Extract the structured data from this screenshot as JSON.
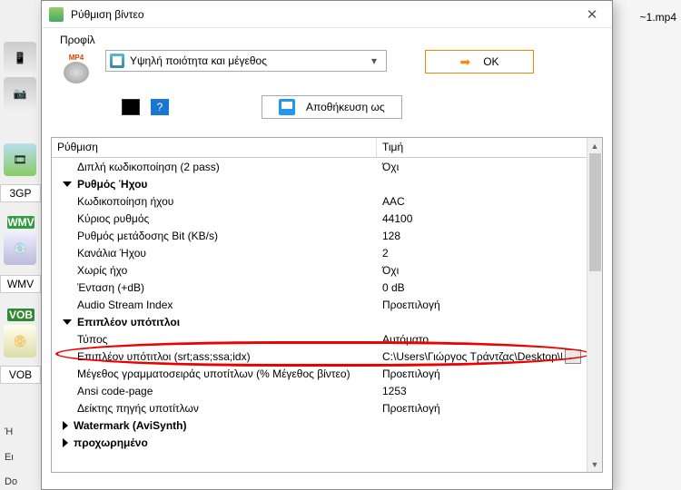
{
  "background": {
    "right_filename": "~1.mp4",
    "buttons": [
      "3GP",
      "WMV",
      "VOB"
    ],
    "badges": [
      {
        "label": "WMV",
        "color": "#349a44"
      },
      {
        "label": "VOB",
        "color": "#338833"
      }
    ],
    "texts": [
      "Ή",
      "Ει",
      "Do"
    ]
  },
  "dialog": {
    "title": "Ρύθμιση βίντεο",
    "profile_label": "Προφίλ",
    "mp4_badge": "MP4",
    "profile_select": "Υψηλή ποιότητα και μέγεθος",
    "ok_label": "OK",
    "help_label": "?",
    "saveas_label": "Αποθήκευση ως"
  },
  "table": {
    "head": {
      "setting": "Ρύθμιση",
      "value": "Τιμή"
    },
    "rows": [
      {
        "t": "item",
        "label": "Διπλή κωδικοποίηση (2 pass)",
        "value": "Όχι"
      },
      {
        "t": "group",
        "label": "Ρυθμός Ήχου"
      },
      {
        "t": "item",
        "label": "Κωδικοποίηση ήχου",
        "value": "AAC"
      },
      {
        "t": "item",
        "label": "Κύριος ρυθμός",
        "value": "44100"
      },
      {
        "t": "item",
        "label": "Ρυθμός μετάδοσης Bit (KB/s)",
        "value": "128"
      },
      {
        "t": "item",
        "label": "Κανάλια Ήχου",
        "value": "2"
      },
      {
        "t": "item",
        "label": "Χωρίς ήχο",
        "value": "Όχι"
      },
      {
        "t": "item",
        "label": "Ένταση (+dB)",
        "value": "0 dB"
      },
      {
        "t": "item",
        "label": "Audio Stream Index",
        "value": "Προεπιλογή"
      },
      {
        "t": "group",
        "label": "Επιπλέον υπότιτλοι"
      },
      {
        "t": "item",
        "label": "Τύπος",
        "value": "Αυτόματο"
      },
      {
        "t": "item",
        "label": "Επιπλέον υπότιτλοι (srt;ass;ssa;idx)",
        "value": "C:\\Users\\Γιώργος Τράντζας\\Desktop\\Νέ",
        "browse": true,
        "highlight": true
      },
      {
        "t": "item",
        "label": "Μέγεθος γραμματοσειράς υποτίτλων (% Μέγεθος βίντεο)",
        "value": "Προεπιλογή"
      },
      {
        "t": "item",
        "label": "Ansi code-page",
        "value": "1253"
      },
      {
        "t": "item",
        "label": "Δείκτης πηγής υποτίτλων",
        "value": "Προεπιλογή"
      },
      {
        "t": "group",
        "label": "Watermark (AviSynth)",
        "collapsed": true
      },
      {
        "t": "group",
        "label": "προχωρημένο",
        "collapsed": true
      }
    ]
  }
}
